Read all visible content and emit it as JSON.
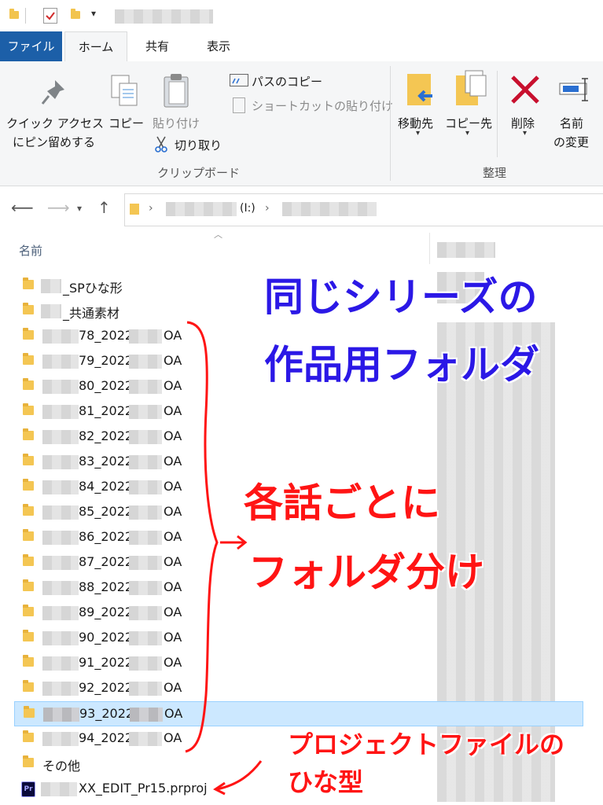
{
  "ribbon_tabs": {
    "file": "ファイル",
    "home": "ホーム",
    "share": "共有",
    "view": "表示"
  },
  "ribbon": {
    "pin_line1": "クイック アクセス",
    "pin_line2": "にピン留めする",
    "copy": "コピー",
    "paste": "貼り付け",
    "copy_path": "パスのコピー",
    "paste_shortcut": "ショートカットの貼り付け",
    "cut": "切り取り",
    "clipboard_group": "クリップボード",
    "move_to": "移動先",
    "copy_to": "コピー先",
    "delete": "削除",
    "rename_line1": "名前",
    "rename_line2": "の変更",
    "organize_group": "整理"
  },
  "address": {
    "drive_label": "(I:)"
  },
  "list": {
    "name_header": "名前",
    "rows": [
      {
        "name": "_SPひな形",
        "suffix": "",
        "type": "folder"
      },
      {
        "name": "_共通素材",
        "suffix": "",
        "type": "folder"
      },
      {
        "name": "78_2022",
        "suffix": "OA",
        "type": "folder"
      },
      {
        "name": "79_2022",
        "suffix": "OA",
        "type": "folder"
      },
      {
        "name": "80_2022",
        "suffix": "OA",
        "type": "folder"
      },
      {
        "name": "81_2022",
        "suffix": "OA",
        "type": "folder"
      },
      {
        "name": "82_2022",
        "suffix": "OA",
        "type": "folder"
      },
      {
        "name": "83_2022",
        "suffix": "OA",
        "type": "folder"
      },
      {
        "name": "84_2022",
        "suffix": "OA",
        "type": "folder"
      },
      {
        "name": "85_2022",
        "suffix": "OA",
        "type": "folder"
      },
      {
        "name": "86_2022",
        "suffix": "OA",
        "type": "folder"
      },
      {
        "name": "87_2022",
        "suffix": "OA",
        "type": "folder"
      },
      {
        "name": "88_2022",
        "suffix": "OA",
        "type": "folder"
      },
      {
        "name": "89_2022",
        "suffix": "OA",
        "type": "folder"
      },
      {
        "name": "90_2022",
        "suffix": "OA",
        "type": "folder"
      },
      {
        "name": "91_2022",
        "suffix": "OA",
        "type": "folder"
      },
      {
        "name": "92_2022",
        "suffix": "OA",
        "type": "folder"
      },
      {
        "name": "93_2022",
        "suffix": "OA",
        "type": "folder",
        "selected": true
      },
      {
        "name": "94_2022",
        "suffix": "OA",
        "type": "folder"
      },
      {
        "name": "その他",
        "suffix": "",
        "type": "folder"
      },
      {
        "name": "XX_EDIT_Pr15.prproj",
        "suffix": "",
        "type": "premiere",
        "icon_text": "Pr"
      }
    ]
  },
  "annotations": {
    "blue_line1": "同じシリーズの",
    "blue_line2": "作品用フォルダ",
    "red_line1": "各話ごとに",
    "red_line2": "フォルダ分け",
    "red_small_line1": "プロジェクトファイルの",
    "red_small_line2": "ひな型"
  },
  "colors": {
    "file_tab": "#1c5fa8",
    "selection": "#cce8ff",
    "annotation_blue": "#2b18e6",
    "annotation_red": "#ff1414"
  }
}
